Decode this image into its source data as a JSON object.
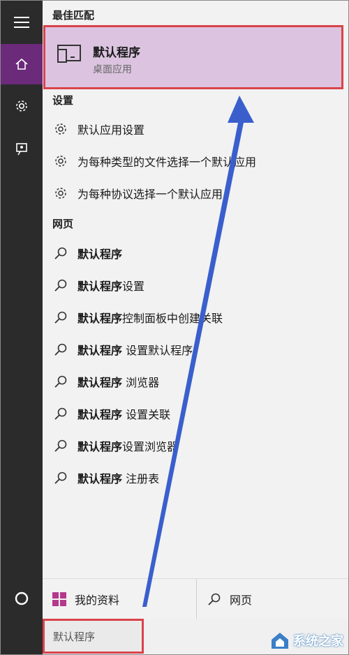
{
  "best_match": {
    "section_label": "最佳匹配",
    "title": "默认程序",
    "subtitle": "桌面应用"
  },
  "settings": {
    "section_label": "设置",
    "items": [
      {
        "label": "默认应用设置",
        "icon": "gear-icon"
      },
      {
        "label": "为每种类型的文件选择一个默认应用",
        "icon": "gear-icon"
      },
      {
        "label": "为每种协议选择一个默认应用",
        "icon": "gear-icon"
      }
    ]
  },
  "web": {
    "section_label": "网页",
    "items": [
      {
        "bold": "默认程序",
        "rest": "",
        "icon": "search-icon"
      },
      {
        "bold": "默认程序",
        "rest": "设置",
        "icon": "search-icon"
      },
      {
        "bold": "默认程序",
        "rest": "控制面板中创建关联",
        "icon": "search-icon"
      },
      {
        "bold": "默认程序",
        "rest": " 设置默认程序",
        "icon": "search-icon"
      },
      {
        "bold": "默认程序",
        "rest": " 浏览器",
        "icon": "search-icon"
      },
      {
        "bold": "默认程序",
        "rest": " 设置关联",
        "icon": "search-icon"
      },
      {
        "bold": "默认程序",
        "rest": "设置浏览器",
        "icon": "search-icon"
      },
      {
        "bold": "默认程序",
        "rest": " 注册表",
        "icon": "search-icon"
      }
    ]
  },
  "bottom_bar": {
    "my_stuff": "我的资料",
    "web": "网页"
  },
  "search": {
    "value": "默认程序"
  },
  "watermark": {
    "text": "系统之家"
  },
  "colors": {
    "rail": "#2b2b2b",
    "rail_active": "#6b2a7a",
    "highlight": "#dcc4e0",
    "annotation_red": "#d9434b",
    "annotation_arrow": "#3a5fcd"
  }
}
